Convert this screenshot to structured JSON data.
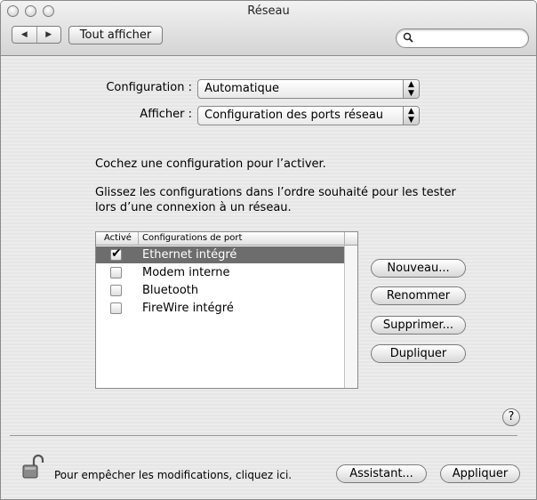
{
  "window": {
    "title": "Réseau"
  },
  "toolbar": {
    "back_glyph": "◀",
    "forward_glyph": "▶",
    "show_all_label": "Tout afficher",
    "search_placeholder": "",
    "search_icon": "magnifier-icon"
  },
  "form": {
    "configuration_label": "Configuration :",
    "configuration_value": "Automatique",
    "show_label": "Afficher :",
    "show_value": "Configuration des ports réseau"
  },
  "instructions": {
    "line1": "Cochez une configuration pour l’activer.",
    "line2": "Glissez les configurations dans l’ordre souhaité pour les tester",
    "line3": "lors d’une connexion à un réseau."
  },
  "ports_list": {
    "headers": {
      "active": "Activé",
      "name": "Configurations de port"
    },
    "rows": [
      {
        "name": "Ethernet intégré",
        "checked": true,
        "selected": true
      },
      {
        "name": "Modem interne",
        "checked": false,
        "selected": false
      },
      {
        "name": "Bluetooth",
        "checked": false,
        "selected": false
      },
      {
        "name": "FireWire intégré",
        "checked": false,
        "selected": false
      }
    ]
  },
  "side_buttons": {
    "new": "Nouveau...",
    "rename": "Renommer",
    "delete": "Supprimer...",
    "duplicate": "Dupliquer"
  },
  "help_label": "?",
  "footer": {
    "lock_text": "Pour empêcher les modifications, cliquez ici.",
    "assistant": "Assistant...",
    "apply": "Appliquer"
  },
  "colors": {
    "selection": "#6d6d6d",
    "window_bg": "#ececec"
  }
}
